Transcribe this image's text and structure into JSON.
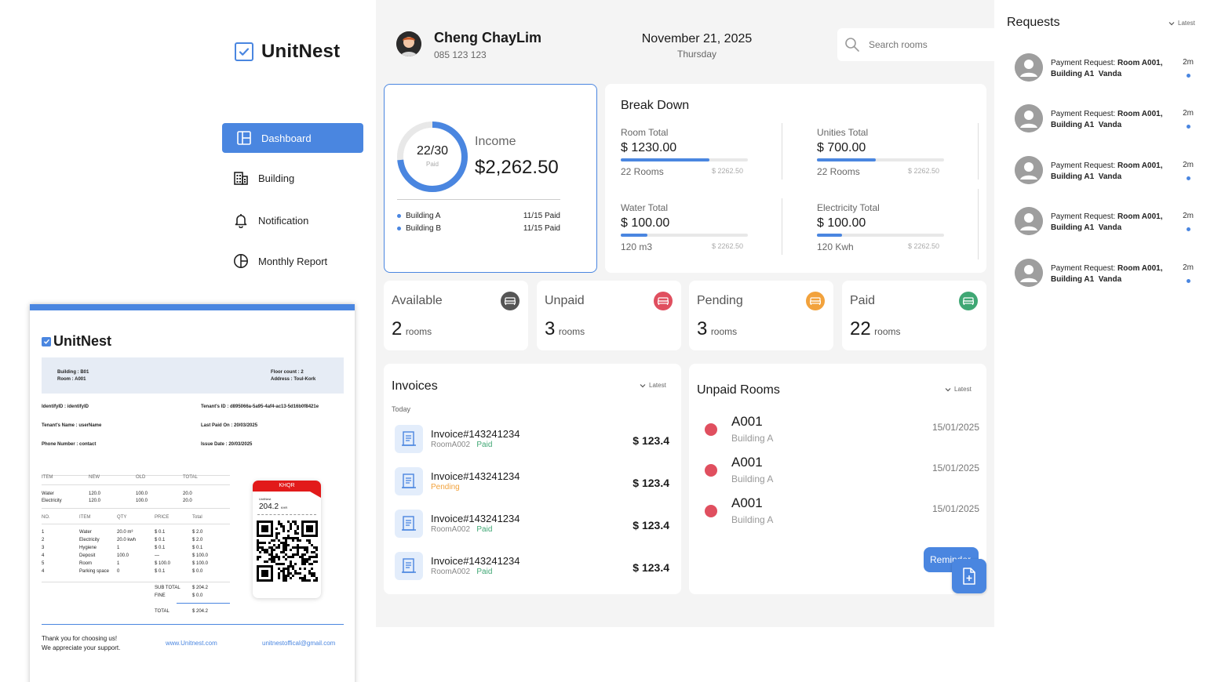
{
  "brand": {
    "name": "UnitNest"
  },
  "nav": {
    "items": [
      {
        "label": "Dashboard"
      },
      {
        "label": "Building"
      },
      {
        "label": "Notification"
      },
      {
        "label": "Monthly Report"
      }
    ]
  },
  "user": {
    "name": "Cheng ChayLim",
    "phone": "085 123 123"
  },
  "date": {
    "full": "November 21, 2025",
    "weekday": "Thursday"
  },
  "search": {
    "placeholder": "Search rooms"
  },
  "income": {
    "paid_ratio": "22/30",
    "paid_label": "Paid",
    "paid_fraction": 0.733,
    "label": "Income",
    "amount": "$2,262.50",
    "buildings": [
      {
        "name": "Building A",
        "status": "11/15 Paid"
      },
      {
        "name": "Building B",
        "status": "11/15 Paid"
      }
    ]
  },
  "breakdown": {
    "title": "Break Down",
    "items": [
      {
        "label": "Room Total",
        "amount": "$ 1230.00",
        "sub": "22 Rooms",
        "max": "$ 2262.50",
        "fraction": 0.7
      },
      {
        "label": "Unities Total",
        "amount": "$ 700.00",
        "sub": "22 Rooms",
        "max": "$ 2262.50",
        "fraction": 0.46
      },
      {
        "label": "Water Total",
        "amount": "$ 100.00",
        "sub": "120 m3",
        "max": "$ 2262.50",
        "fraction": 0.21
      },
      {
        "label": "Electricity Total",
        "amount": "$ 100.00",
        "sub": "120 Kwh",
        "max": "$ 2262.50",
        "fraction": 0.2
      }
    ]
  },
  "stats": [
    {
      "label": "Available",
      "count": "2",
      "unit": "rooms",
      "color": "#555555"
    },
    {
      "label": "Unpaid",
      "count": "3",
      "unit": "rooms",
      "color": "#e04f5f"
    },
    {
      "label": "Pending",
      "count": "3",
      "unit": "rooms",
      "color": "#f2a23c"
    },
    {
      "label": "Paid",
      "count": "22",
      "unit": "rooms",
      "color": "#3fa774"
    }
  ],
  "invoices": {
    "title": "Invoices",
    "sort": "Latest",
    "group": "Today",
    "rows": [
      {
        "title": "Invoice#143241234",
        "room": "RoomA002",
        "status": "Paid",
        "status_color": "#3fa774",
        "amount": "$ 123.4"
      },
      {
        "title": "Invoice#143241234",
        "room": "",
        "status": "Pending",
        "status_color": "#f2a23c",
        "amount": "$ 123.4"
      },
      {
        "title": "Invoice#143241234",
        "room": "RoomA002",
        "status": "Paid",
        "status_color": "#3fa774",
        "amount": "$ 123.4"
      },
      {
        "title": "Invoice#143241234",
        "room": "RoomA002",
        "status": "Paid",
        "status_color": "#3fa774",
        "amount": "$ 123.4"
      }
    ]
  },
  "unpaid": {
    "title": "Unpaid Rooms",
    "sort": "Latest",
    "button": "Reminder",
    "rows": [
      {
        "name": "A001",
        "building": "Building A",
        "date": "15/01/2025"
      },
      {
        "name": "A001",
        "building": "Building A",
        "date": "15/01/2025"
      },
      {
        "name": "A001",
        "building": "Building A",
        "date": "15/01/2025"
      }
    ]
  },
  "requests": {
    "title": "Requests",
    "sort": "Latest",
    "items": [
      {
        "prefix": "Payment Request: ",
        "room": "Room A001,",
        "building": "Building A1",
        "name": "Vanda",
        "time": "2m"
      },
      {
        "prefix": "Payment Request: ",
        "room": "Room A001,",
        "building": "Building A1",
        "name": "Vanda",
        "time": "2m"
      },
      {
        "prefix": "Payment Request: ",
        "room": "Room A001,",
        "building": "Building A1",
        "name": "Vanda",
        "time": "2m"
      },
      {
        "prefix": "Payment Request: ",
        "room": "Room A001,",
        "building": "Building A1",
        "name": "Vanda",
        "time": "2m"
      },
      {
        "prefix": "Payment Request: ",
        "room": "Room A001,",
        "building": "Building A1",
        "name": "Vanda",
        "time": "2m"
      }
    ]
  },
  "doc": {
    "brand": "UnitNest",
    "building": "Building : B01",
    "room": "Room : A001",
    "floor": "Floor count : 2",
    "address": "Address    : Toul-Kork",
    "identify": "IdentifyID    : identifyID",
    "tenant_id": "Tenant's ID  : d895066a-5a95-4af4-ac13-5d16b0f8421e",
    "tenant_name": "Tenant's Name : userName",
    "last_paid": "Last Paid On :  20/03/2025",
    "phone": "Phone Number  : contact",
    "issue": "Issue Date    : 20/03/2025",
    "meter_head": [
      "ITEM",
      "NEW",
      "OLD",
      "TOTAL"
    ],
    "meter_rows": [
      [
        "Water",
        "120.0",
        "100.0",
        "20.0"
      ],
      [
        "Electricity",
        "120.0",
        "100.0",
        "20.0"
      ]
    ],
    "item_head": [
      "NO.",
      "ITEM",
      "QTY",
      "PRICE",
      "Total"
    ],
    "item_rows": [
      [
        "1",
        "Water",
        "20.0 m³",
        "$ 0.1",
        "$ 2.0"
      ],
      [
        "2",
        "Electricity",
        "20.0 kwh",
        "$ 0.1",
        "$ 2.0"
      ],
      [
        "3",
        "Hygiene",
        "1",
        "$ 0.1",
        "$ 0.1"
      ],
      [
        "4",
        "Deposit",
        "100.0",
        "—",
        "$ 100.0"
      ],
      [
        "5",
        "Room",
        "1",
        "$ 100.0",
        "$ 100.0"
      ],
      [
        "4",
        "Parking space",
        "0",
        "$ 0.1",
        "$ 0.0"
      ]
    ],
    "subtotal_label": "SUB TOTAL",
    "subtotal": "$ 204.2",
    "fine_label": "FINE",
    "fine": "$ 0.0",
    "total_label": "TOTAL",
    "total": "$ 204.2",
    "khqr": "KHQR",
    "khqr_brand": "UnitNest",
    "khqr_amount": "204.2",
    "khqr_currency": "KHR",
    "thanks1": "Thank you for choosing us!",
    "thanks2": "We appreciate your support.",
    "website": "www.Unitnest.com",
    "email": "unitnestoffical@gmail.com"
  }
}
